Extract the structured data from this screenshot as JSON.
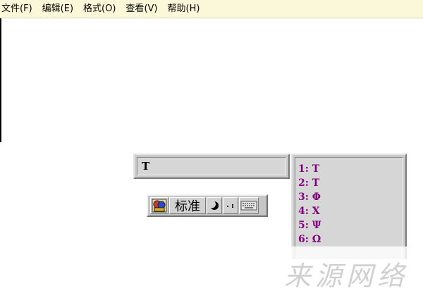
{
  "menu": {
    "items": [
      {
        "label": "文件",
        "accel": "(F)"
      },
      {
        "label": "编辑",
        "accel": "(E)"
      },
      {
        "label": "格式",
        "accel": "(O)"
      },
      {
        "label": "查看",
        "accel": "(V)"
      },
      {
        "label": "帮助",
        "accel": "(H)"
      }
    ]
  },
  "composition": {
    "text": "T"
  },
  "ime": {
    "mode_label": "标准",
    "logo_icon": "ime-logo-icon",
    "width_icon": "half-moon-icon",
    "punct_icon": "punctuation-icon",
    "keyboard_icon": "soft-keyboard-icon"
  },
  "candidates": [
    "1: Τ",
    "2: Τ",
    "3: Φ",
    "4: Χ",
    "5: Ψ",
    "6: Ω"
  ],
  "watermark": {
    "text": "来源网络"
  },
  "colors": {
    "menubar_bg": "#fbf8d9",
    "candidate_text": "#800080",
    "panel_gray": "#c9c9c9"
  }
}
